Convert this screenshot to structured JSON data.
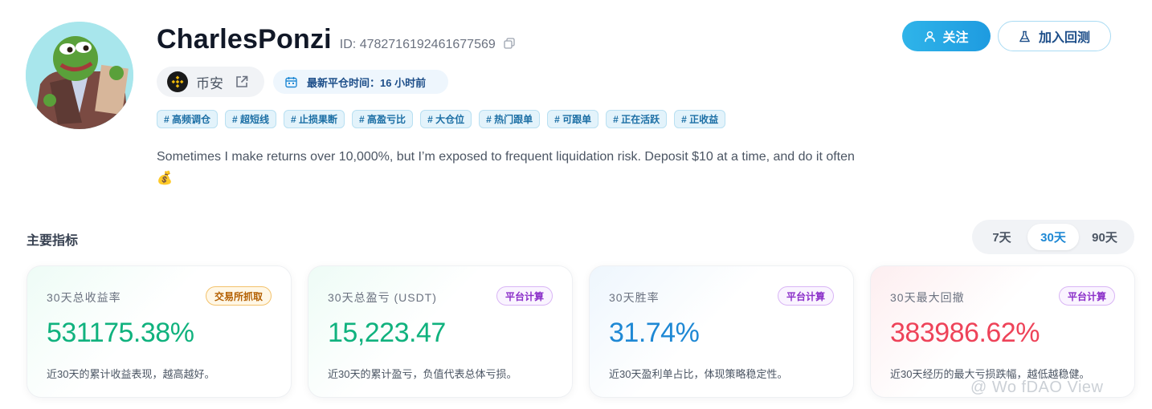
{
  "profile": {
    "username": "CharlesPonzi",
    "id_text": "ID: 4782716192461677569",
    "exchange": "币安",
    "last_close": "最新平仓时间：16 小时前",
    "tags": [
      "# 高频调仓",
      "# 超短线",
      "# 止损果断",
      "# 高盈亏比",
      "# 大仓位",
      "# 热门跟单",
      "# 可跟单",
      "# 正在活跃",
      "# 正收益"
    ],
    "bio": "Sometimes I make returns over 10,000%, but I’m exposed to frequent liquidation risk. Deposit $10 at a time, and do it often 💰"
  },
  "actions": {
    "follow_label": "关注",
    "backtest_label": "加入回测"
  },
  "metrics": {
    "title": "主要指标",
    "periods": [
      "7天",
      "30天",
      "90天"
    ],
    "active_period": "30天",
    "cards": [
      {
        "label": "30天总收益率",
        "badge": "交易所抓取",
        "value": "531175.38%",
        "desc": "近30天的累计收益表现，越高越好。"
      },
      {
        "label": "30天总盈亏 (USDT)",
        "badge": "平台计算",
        "value": "15,223.47",
        "desc": "近30天的累计盈亏，负值代表总体亏损。"
      },
      {
        "label": "30天胜率",
        "badge": "平台计算",
        "value": "31.74%",
        "desc": "近30天盈利单占比，体现策略稳定性。"
      },
      {
        "label": "30天最大回撤",
        "badge": "平台计算",
        "value": "383986.62%",
        "desc": "近30天经历的最大亏损跌幅，越低越稳健。"
      }
    ]
  },
  "watermark": "@ Wo fDAO View",
  "colors": {
    "accent": "#1e9be0",
    "positive": "#10b27e",
    "info": "#1e88d4",
    "negative": "#ee4359"
  },
  "icons": {
    "copy": "copy-icon",
    "exchange_logo": "binance-logo-icon",
    "external": "external-link-icon",
    "calendar": "calendar-icon",
    "follow": "user-icon",
    "backtest": "flask-icon"
  }
}
